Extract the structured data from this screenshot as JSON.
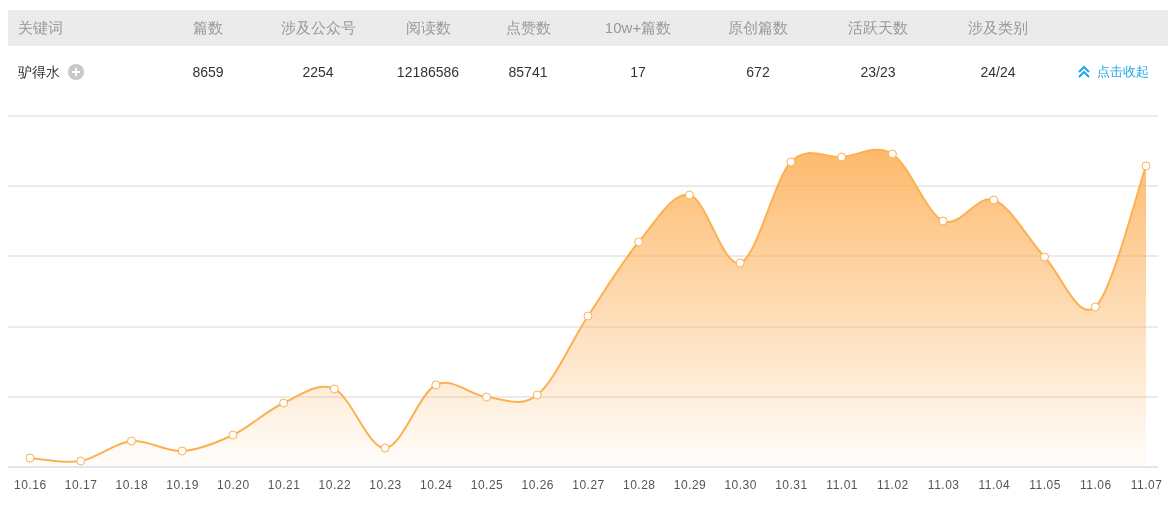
{
  "table": {
    "columns": [
      "关键词",
      "篇数",
      "涉及公众号",
      "阅读数",
      "点赞数",
      "10w+篇数",
      "原创篇数",
      "活跃天数",
      "涉及类别"
    ],
    "row": {
      "keyword": "驴得水",
      "values": [
        "8659",
        "2254",
        "12186586",
        "85741",
        "17",
        "672",
        "23/23",
        "24/24"
      ],
      "action": "点击收起"
    }
  },
  "trend": {
    "x_labels": [
      "10.16",
      "10.17",
      "10.18",
      "10.19",
      "10.20",
      "10.21",
      "10.22",
      "10.23",
      "10.24",
      "10.25",
      "10.26",
      "10.27",
      "10.28",
      "10.29",
      "10.30",
      "10.31",
      "11.01",
      "11.02",
      "11.03",
      "11.04",
      "11.05",
      "11.06",
      "11.07"
    ]
  }
}
